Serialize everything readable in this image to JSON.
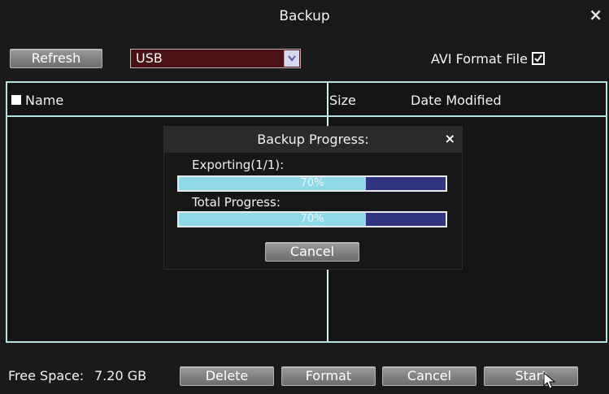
{
  "window": {
    "title": "Backup",
    "close_icon": "close-icon",
    "close_glyph": "×"
  },
  "toolbar": {
    "refresh_label": "Refresh",
    "device_select": {
      "value": "USB",
      "arrow_icon": "chevron-down-icon"
    },
    "avi_label": "AVI Format File",
    "avi_checked": true
  },
  "table": {
    "columns": [
      "Name",
      "Size",
      "Date Modified"
    ],
    "select_all_checked": false,
    "border_color": "#b6e4e2"
  },
  "dialog": {
    "title": "Backup Progress:",
    "close_glyph": "×",
    "exporting_label": "Exporting(1/1):",
    "exporting_progress": 0.7,
    "exporting_text": "70%",
    "total_label": "Total Progress:",
    "total_progress": 0.7,
    "total_text": "70%",
    "cancel_label": "Cancel",
    "fill_color": "#8fd9e8",
    "bar_color": "#343484"
  },
  "footer": {
    "free_space_label": "Free Space:",
    "free_space_value": "7.20 GB",
    "delete_label": "Delete",
    "format_label": "Format",
    "cancel_label": "Cancel",
    "start_label": "Start",
    "cursor_icon": "mouse-pointer-icon"
  }
}
